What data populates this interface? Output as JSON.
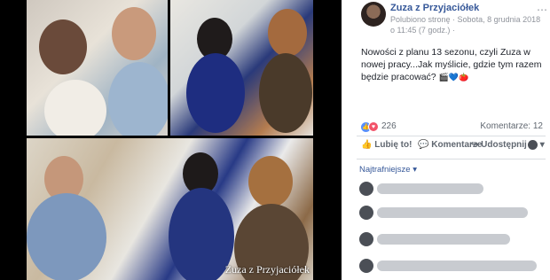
{
  "post": {
    "page_name": "Zuza z Przyjaciółek",
    "meta": "Polubiono stronę · Sobota, 8 grudnia 2018 o 11:45 (7 godz.) ·",
    "text": "Nowości z planu 13 sezonu, czyli Zuza w nowej pracy...Jak myślicie, gdzie tym razem będzie pracować?",
    "emojis": "🎬💙🍅"
  },
  "photo": {
    "watermark": "Zuza z Przyjaciółek"
  },
  "reactions": {
    "count": "226",
    "comments": "Komentarze: 12"
  },
  "actions": {
    "like": "Lubię to!",
    "comment": "Komentarze",
    "share": "Udostępnij"
  },
  "comments": {
    "sort_label": "Najtrafniejsze ▾"
  },
  "colors": {
    "link": "#365899",
    "like": "#5890ff",
    "love": "#f25268"
  }
}
